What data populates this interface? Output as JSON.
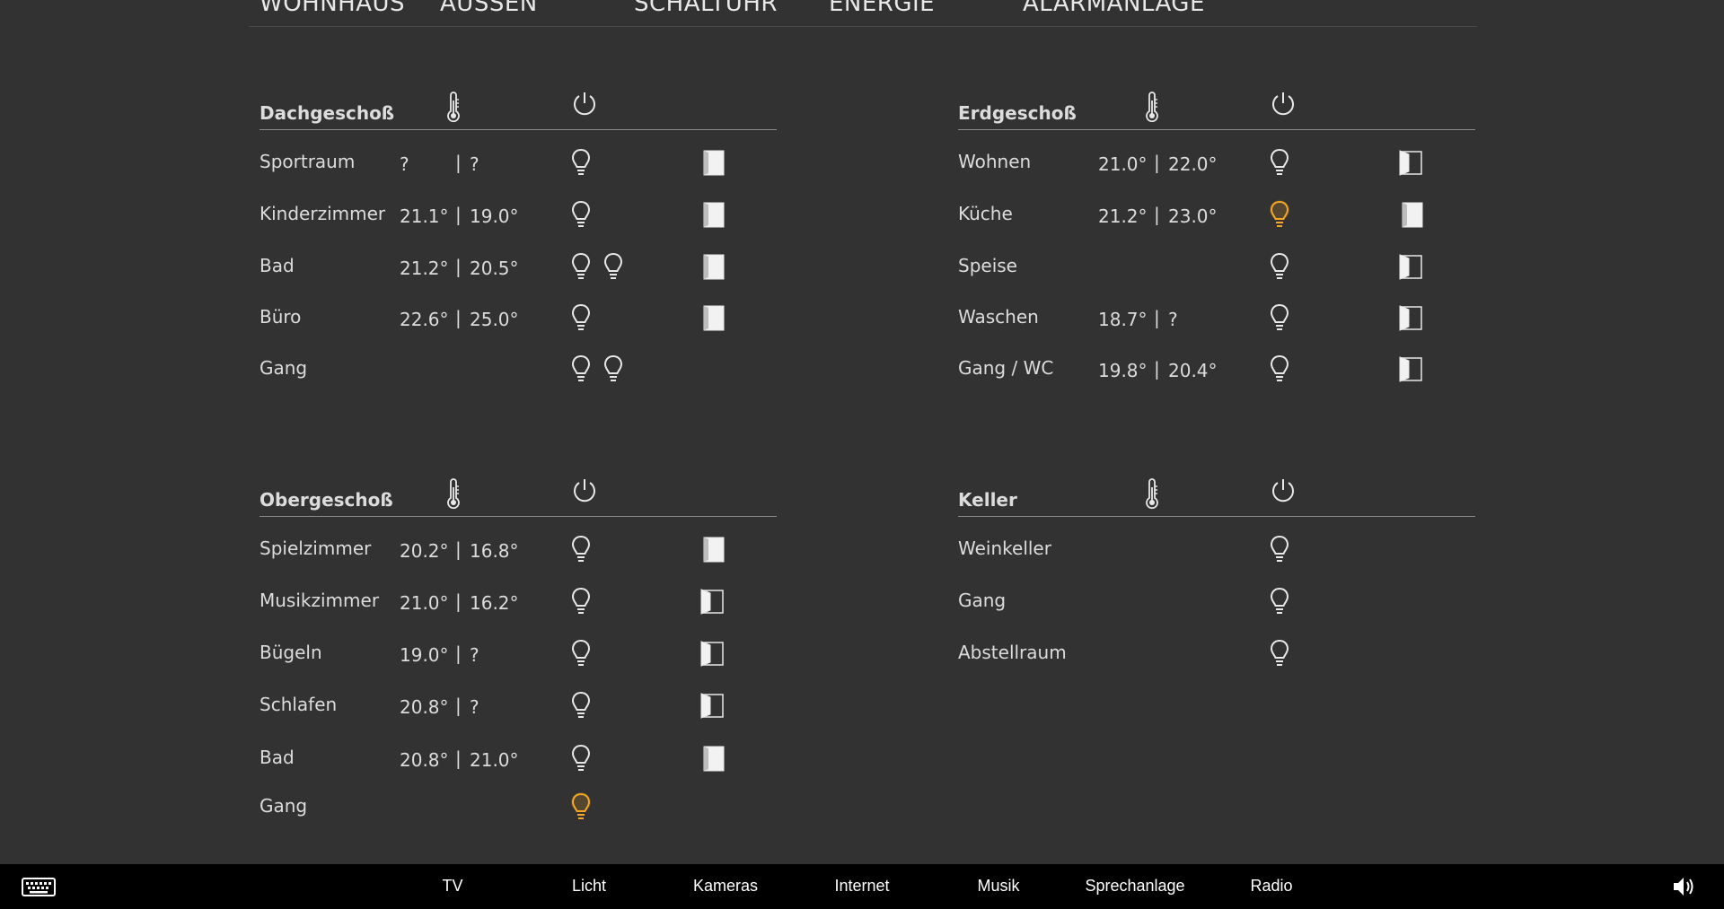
{
  "topnav": {
    "tabs": [
      {
        "label": "WOHNHAUS",
        "active": true
      },
      {
        "label": "AUSSEN",
        "active": false
      },
      {
        "label": "SCHALTUHR",
        "active": false
      },
      {
        "label": "ENERGIE",
        "active": false
      },
      {
        "label": "ALARMANLAGE",
        "active": false
      }
    ]
  },
  "colors": {
    "accent": "#f5a623",
    "background": "#323232",
    "text": "#dcdcdc",
    "bar": "#000000"
  },
  "sections": [
    {
      "title": "Dachgeschoß",
      "rooms": [
        {
          "name": "Sportraum",
          "temp_current": "?",
          "temp_target": "?",
          "bulbs": [
            false
          ],
          "shutter": "closed"
        },
        {
          "name": "Kinderzimmer",
          "temp_current": "21.1°",
          "temp_target": "19.0°",
          "bulbs": [
            false
          ],
          "shutter": "closed"
        },
        {
          "name": "Bad",
          "temp_current": "21.2°",
          "temp_target": "20.5°",
          "bulbs": [
            false,
            false
          ],
          "shutter": "closed"
        },
        {
          "name": "Büro",
          "temp_current": "22.6°",
          "temp_target": "25.0°",
          "bulbs": [
            false
          ],
          "shutter": "closed"
        },
        {
          "name": "Gang",
          "temp_current": "",
          "temp_target": "",
          "bulbs": [
            false,
            false
          ],
          "shutter": "none"
        }
      ]
    },
    {
      "title": "Erdgeschoß",
      "rooms": [
        {
          "name": "Wohnen",
          "temp_current": "21.0°",
          "temp_target": "22.0°",
          "bulbs": [
            false
          ],
          "shutter": "open"
        },
        {
          "name": "Küche",
          "temp_current": "21.2°",
          "temp_target": "23.0°",
          "bulbs": [
            true
          ],
          "shutter": "closed"
        },
        {
          "name": "Speise",
          "temp_current": "",
          "temp_target": "",
          "bulbs": [
            false
          ],
          "shutter": "open"
        },
        {
          "name": "Waschen",
          "temp_current": "18.7°",
          "temp_target": "?",
          "bulbs": [
            false
          ],
          "shutter": "open"
        },
        {
          "name": "Gang / WC",
          "temp_current": "19.8°",
          "temp_target": "20.4°",
          "bulbs": [
            false
          ],
          "shutter": "open"
        }
      ]
    },
    {
      "title": "Obergeschoß",
      "rooms": [
        {
          "name": "Spielzimmer",
          "temp_current": "20.2°",
          "temp_target": "16.8°",
          "bulbs": [
            false
          ],
          "shutter": "closed"
        },
        {
          "name": "Musikzimmer",
          "temp_current": "21.0°",
          "temp_target": "16.2°",
          "bulbs": [
            false
          ],
          "shutter": "open"
        },
        {
          "name": "Bügeln",
          "temp_current": "19.0°",
          "temp_target": "?",
          "bulbs": [
            false
          ],
          "shutter": "open"
        },
        {
          "name": "Schlafen",
          "temp_current": "20.8°",
          "temp_target": "?",
          "bulbs": [
            false
          ],
          "shutter": "open"
        },
        {
          "name": "Bad",
          "temp_current": "20.8°",
          "temp_target": "21.0°",
          "bulbs": [
            false
          ],
          "shutter": "closed"
        },
        {
          "name": "Gang",
          "temp_current": "",
          "temp_target": "",
          "bulbs": [
            true
          ],
          "shutter": "none"
        }
      ]
    },
    {
      "title": "Keller",
      "rooms": [
        {
          "name": "Weinkeller",
          "temp_current": "",
          "temp_target": "",
          "bulbs": [
            false
          ],
          "shutter": "none"
        },
        {
          "name": "Gang",
          "temp_current": "",
          "temp_target": "",
          "bulbs": [
            false
          ],
          "shutter": "none"
        },
        {
          "name": "Abstellraum",
          "temp_current": "",
          "temp_target": "",
          "bulbs": [
            false
          ],
          "shutter": "none"
        }
      ]
    }
  ],
  "bottombar": {
    "items": [
      "TV",
      "Licht",
      "Kameras",
      "Internet",
      "Musik",
      "Sprechanlage",
      "Radio"
    ],
    "keyboard_icon": "keyboard-icon",
    "volume_icon": "speaker-volume-icon"
  }
}
